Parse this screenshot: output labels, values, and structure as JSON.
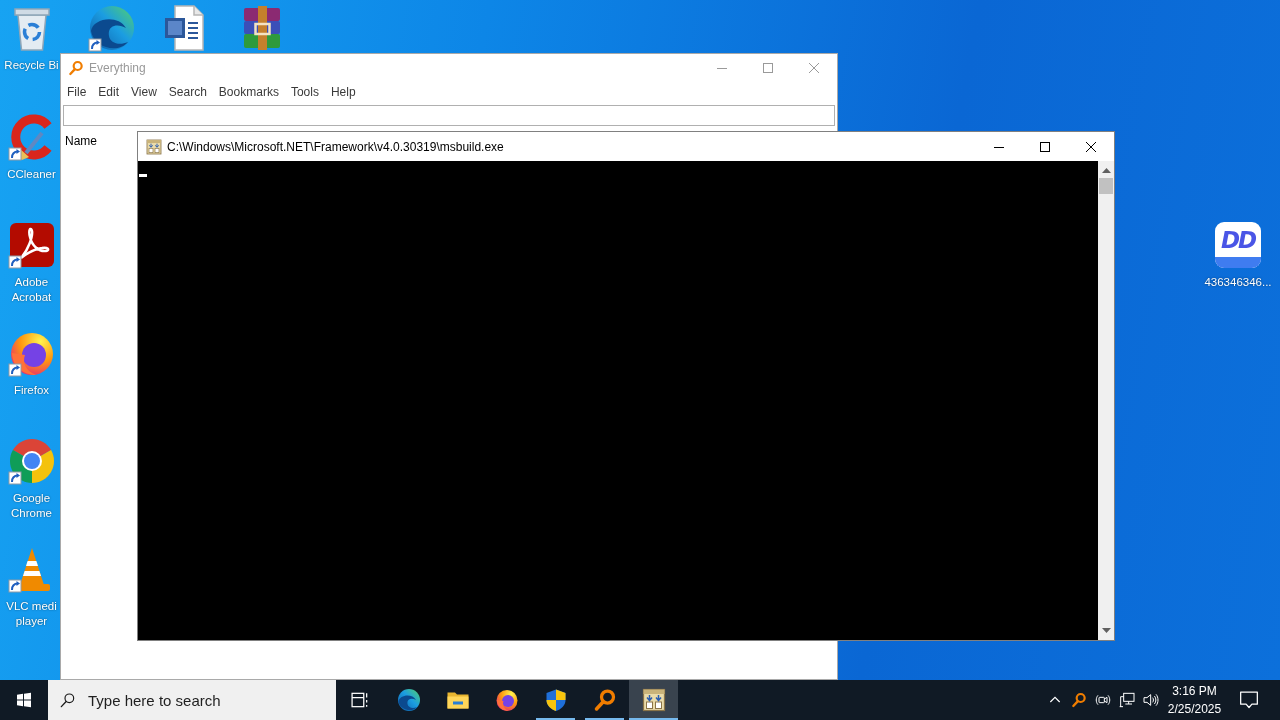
{
  "desktop": {
    "icons": [
      {
        "kind": "bin",
        "label": "Recycle Bi",
        "shortcut": false
      },
      {
        "kind": "swirl",
        "shortcut": true
      },
      {
        "kind": "document",
        "shortcut": false
      },
      {
        "kind": "archive",
        "shortcut": false
      },
      {
        "kind": "cleaner",
        "label": "CCleaner",
        "shortcut": true
      },
      {
        "kind": "pdf",
        "label": "Adobe Acrobat",
        "shortcut": true
      },
      {
        "kind": "fox",
        "label": "Firefox",
        "shortcut": true
      },
      {
        "kind": "rings",
        "label": "Google Chrome",
        "shortcut": true
      },
      {
        "kind": "cone",
        "label": "VLC medi player",
        "shortcut": true
      },
      {
        "kind": "tile",
        "logo": "DD",
        "label": "436346346..."
      }
    ]
  },
  "search_window": {
    "title": "Everything",
    "active": false,
    "menu": [
      "File",
      "Edit",
      "View",
      "Search",
      "Bookmarks",
      "Tools",
      "Help"
    ],
    "columns": [
      "Name"
    ]
  },
  "console_window": {
    "title": "C:\\Windows\\Microsoft.NET\\Framework\\v4.0.30319\\msbuild.exe",
    "active": true
  },
  "taskbar": {
    "search": {
      "placeholder": "Type here to search"
    },
    "apps": [
      {
        "kind": "swirl",
        "running": false,
        "selected": false
      },
      {
        "kind": "folder",
        "running": false,
        "selected": false
      },
      {
        "kind": "fox",
        "running": false,
        "selected": false
      },
      {
        "kind": "shield",
        "running": true,
        "selected": false
      },
      {
        "kind": "magnifier",
        "running": true,
        "selected": false
      },
      {
        "kind": "console",
        "running": true,
        "selected": true
      }
    ],
    "clock": {
      "time": "3:16 PM",
      "date": "2/25/2025"
    }
  }
}
